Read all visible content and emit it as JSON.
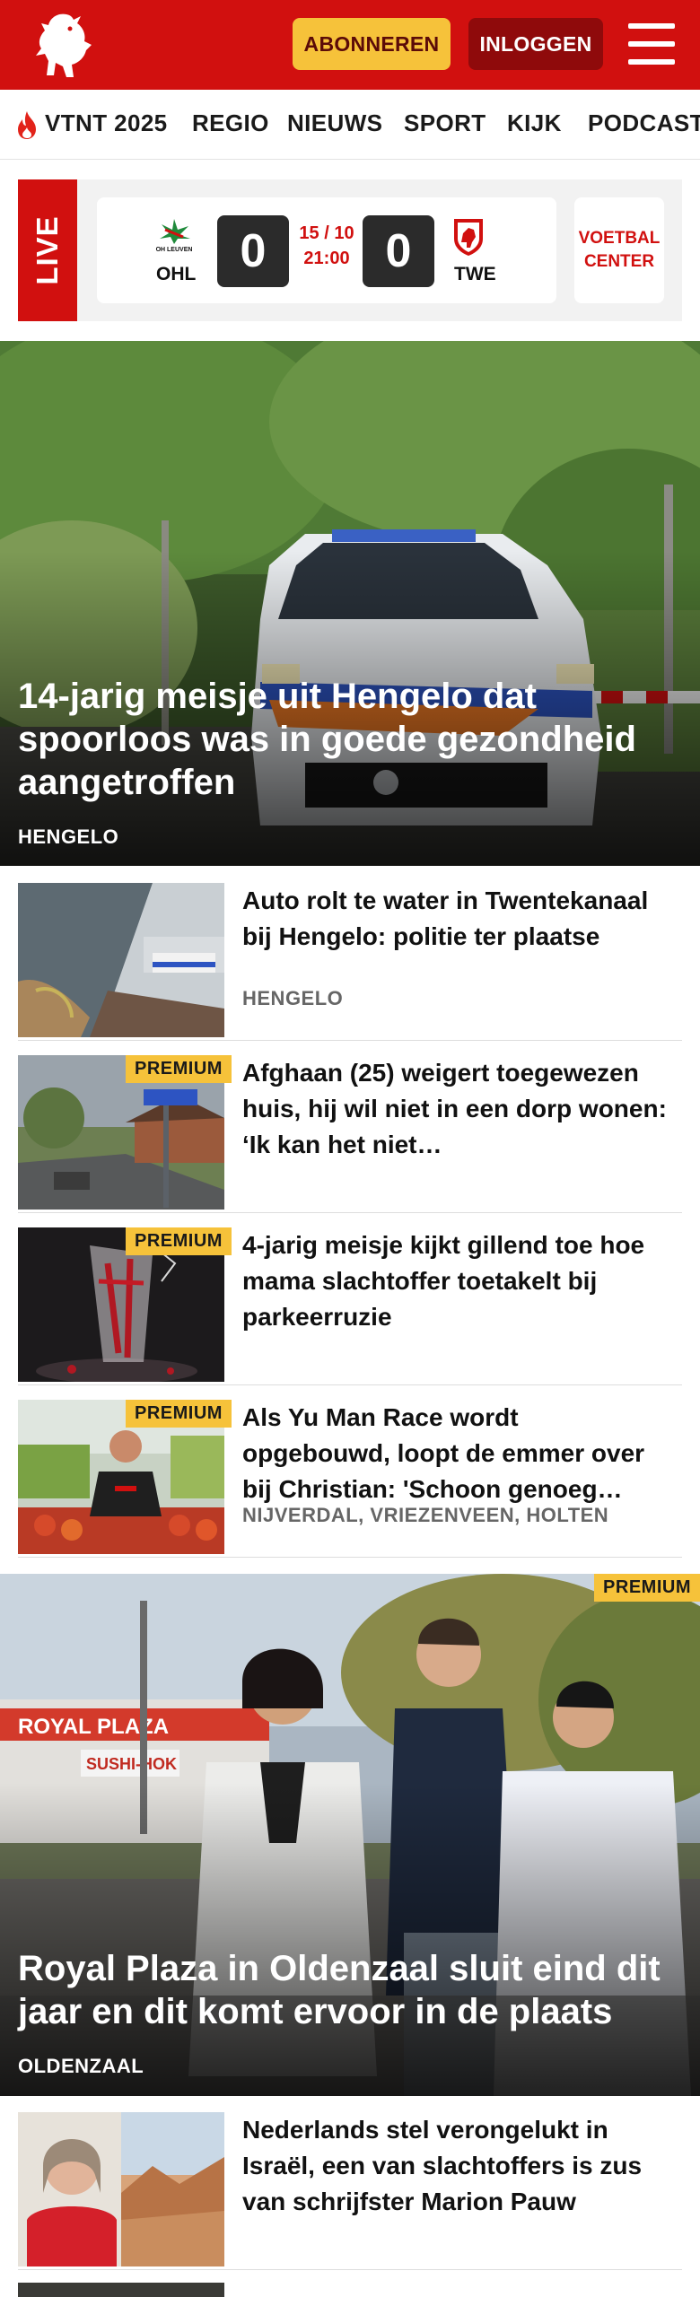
{
  "header": {
    "subscribe_label": "ABONNEREN",
    "login_label": "INLOGGEN",
    "brand_color": "#d1100f"
  },
  "nav": {
    "items": [
      "VTNT 2025",
      "REGIO",
      "NIEUWS",
      "SPORT",
      "KIJK",
      "PODCAST"
    ]
  },
  "live": {
    "tag": "LIVE",
    "home": {
      "name": "OHL",
      "logo_text": "OH LEUVEN",
      "score": "0"
    },
    "away": {
      "name": "TWE",
      "score": "0"
    },
    "date": "15 / 10",
    "time": "21:00",
    "center_label_1": "VOETBAL",
    "center_label_2": "CENTER"
  },
  "hero": {
    "title": "14-jarig meisje uit Hengelo dat spoorloos was in goede gezondheid aangetroffen",
    "location": "HENGELO"
  },
  "articles": [
    {
      "title": "Auto rolt te water in Twentekanaal bij Hengelo: politie ter plaatse",
      "location": "HENGELO",
      "premium": ""
    },
    {
      "title": "Afghaan (25) weigert toegewezen huis, hij wil niet in een dorp wonen: ‘Ik kan het niet…",
      "location": "",
      "premium": "PREMIUM"
    },
    {
      "title": "4-jarig meisje kijkt gillend toe hoe mama slachtoffer toetakelt bij parkeerruzie",
      "location": "",
      "premium": "PREMIUM"
    },
    {
      "title": "Als Yu Man Race wordt opgebouwd, loopt de emmer over bij Christian: 'Schoon genoeg…",
      "location": "NIJVERDAL, VRIEZENVEEN, HOLTEN",
      "premium": "PREMIUM"
    }
  ],
  "hero2": {
    "title": "Royal Plaza in Oldenzaal sluit eind dit jaar en dit komt ervoor in de plaats",
    "location": "OLDENZAAL",
    "premium": "PREMIUM",
    "sign_royal": "ROYAL PLAZA",
    "sign_sushi": "SUSHI-HOK"
  },
  "articles2": [
    {
      "title": "Nederlands stel verongelukt in Israël, een van slachtoffers is zus van schrijfster Marion Pauw",
      "location": "",
      "premium": ""
    }
  ]
}
